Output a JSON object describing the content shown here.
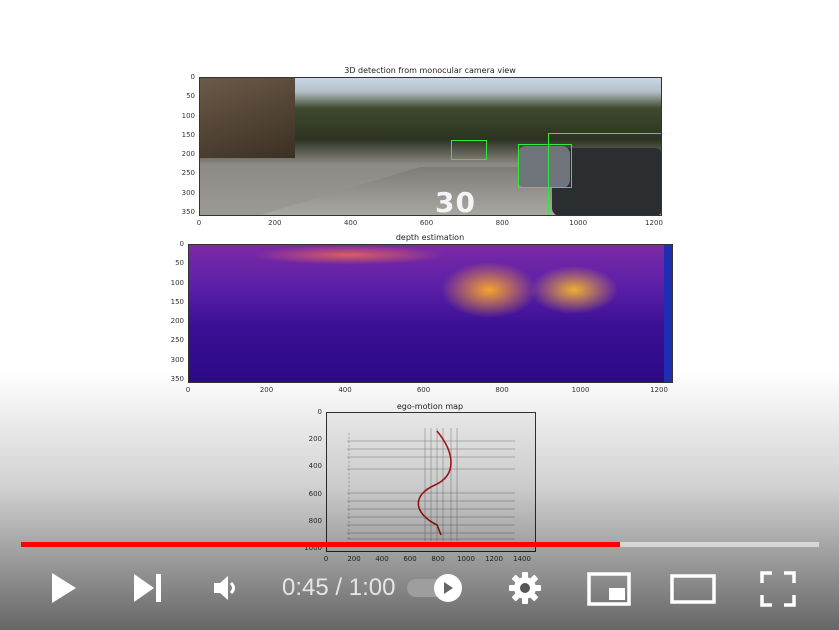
{
  "video": {
    "panels": {
      "camera": {
        "title": "3D detection from monocular camera view",
        "y_ticks": [
          "0",
          "50",
          "100",
          "150",
          "200",
          "250",
          "300",
          "350"
        ],
        "x_ticks": [
          "0",
          "200",
          "400",
          "600",
          "800",
          "1000",
          "1200"
        ],
        "road_marking": "30"
      },
      "depth": {
        "title": "depth estimation",
        "y_ticks": [
          "0",
          "50",
          "100",
          "150",
          "200",
          "250",
          "300",
          "350"
        ],
        "x_ticks": [
          "0",
          "200",
          "400",
          "600",
          "800",
          "1000",
          "1200"
        ]
      },
      "ego": {
        "title": "ego-motion map",
        "y_ticks": [
          "0",
          "200",
          "400",
          "600",
          "800",
          "1000"
        ],
        "x_ticks": [
          "0",
          "200",
          "400",
          "600",
          "800",
          "1000",
          "1200",
          "1400"
        ]
      }
    }
  },
  "controls": {
    "progress": {
      "played_fraction": 0.75,
      "played_color": "#ff0000",
      "track_color": "#d9d9d9"
    },
    "time": {
      "current": "0:45",
      "separator": " / ",
      "duration": "1:00"
    },
    "icons": {
      "play": "play-icon",
      "next": "next-icon",
      "volume": "volume-icon",
      "autoplay": "autoplay-icon",
      "settings": "gear-icon",
      "miniplayer": "miniplayer-icon",
      "theater": "theater-icon",
      "fullscreen": "fullscreen-icon"
    }
  }
}
